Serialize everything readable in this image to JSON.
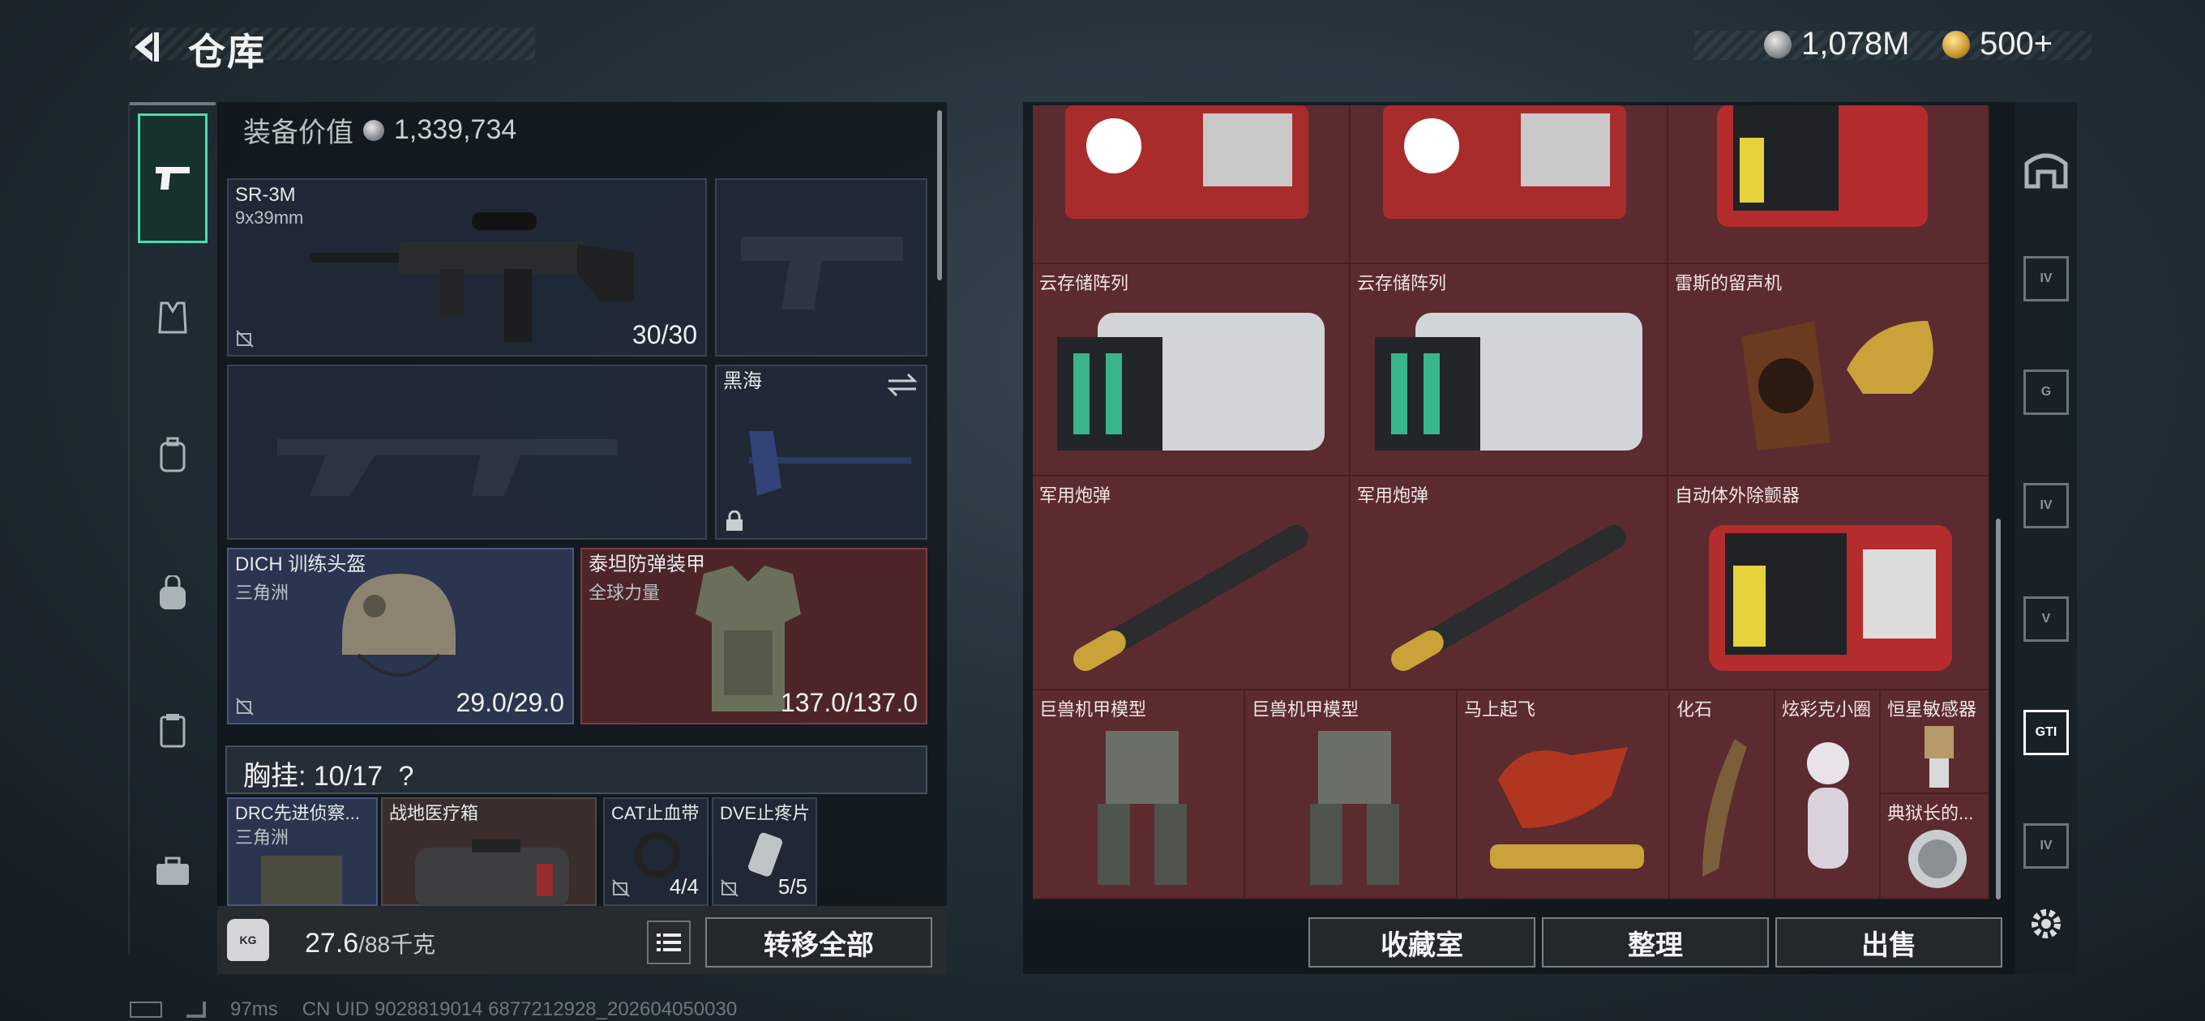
{
  "header": {
    "title": "仓库",
    "currency": [
      {
        "icon": "silver-coin-icon",
        "value": "1,078M"
      },
      {
        "icon": "gold-coin-icon",
        "value": "500+"
      }
    ]
  },
  "equipment": {
    "value_label": "装备价值",
    "value": "1,339,734",
    "primary_weapon": {
      "name": "SR-3M",
      "caliber": "9x39mm",
      "durability": "30/30"
    },
    "melee": {
      "name": "黑海"
    },
    "helmet": {
      "name": "DICH 训练头盔",
      "sub": "三角洲",
      "durability": "29.0/29.0"
    },
    "armor": {
      "name": "泰坦防弹装甲",
      "sub": "全球力量",
      "durability": "137.0/137.0"
    },
    "rig_label": "胸挂: 10/17",
    "rig_help": "?",
    "rig_items": [
      {
        "name": "DRC先进侦察...",
        "sub": "三角洲"
      },
      {
        "name": "战地医疗箱"
      },
      {
        "name": "CAT止血带",
        "count": "4/4"
      },
      {
        "name": "DVE止疼片",
        "count": "5/5"
      }
    ],
    "weight": "27.6",
    "weight_max": "/88千克",
    "bag_icon_text": "KG",
    "transfer_all": "转移全部"
  },
  "stash": {
    "row0": [
      {
        "name": ""
      },
      {
        "name": ""
      },
      {
        "name": ""
      }
    ],
    "row1": [
      {
        "name": "云存储阵列"
      },
      {
        "name": "云存储阵列"
      },
      {
        "name": "雷斯的留声机"
      }
    ],
    "row2": [
      {
        "name": "军用炮弹"
      },
      {
        "name": "军用炮弹"
      },
      {
        "name": "自动体外除颤器"
      }
    ],
    "row3": [
      {
        "name": "巨兽机甲模型"
      },
      {
        "name": "巨兽机甲模型"
      },
      {
        "name": "马上起飞"
      },
      {
        "name": "化石"
      },
      {
        "name": "炫彩克小圈"
      },
      {
        "name": "恒星敏感器"
      },
      {
        "name": "典狱长的..."
      }
    ],
    "buttons": {
      "collection": "收藏室",
      "sort": "整理",
      "sell": "出售"
    }
  },
  "right_rail": [
    "home-icon",
    "IV",
    "G",
    "IV",
    "V",
    "GTI",
    "IV"
  ],
  "footer": {
    "ping": "97ms",
    "uid": "CN UID 9028819014 6877212928_202604050030"
  },
  "colors": {
    "accent": "#3fe0b0",
    "stash_bg": "#5c2b2f",
    "panel_bg": "#0e141a"
  }
}
